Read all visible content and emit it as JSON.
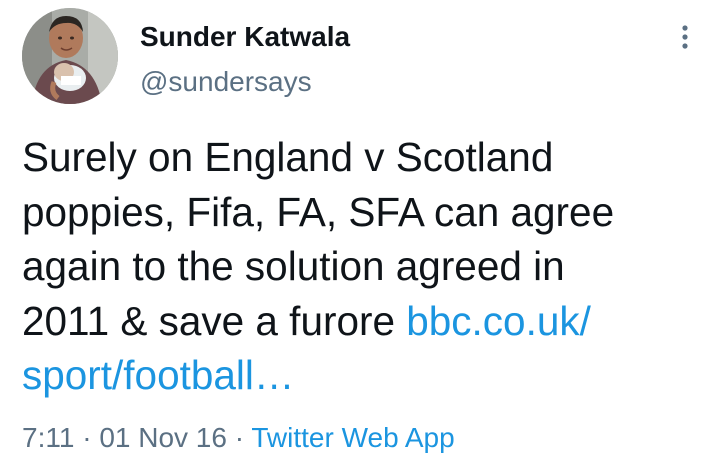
{
  "author": {
    "display_name": "Sunder Katwala",
    "handle": "@sundersays"
  },
  "tweet": {
    "text_lines": [
      "Surely on England v Scotland",
      "poppies, Fifa, FA, SFA can agree",
      "again to the solution agreed in",
      "2011 & save a furore "
    ],
    "link_part1": "bbc.co.uk/",
    "link_part2": "sport/football…"
  },
  "meta": {
    "time": "7:11",
    "separator": "·",
    "date": "01 Nov 16",
    "source": "Twitter Web App"
  },
  "icons": {
    "more": "more-vertical-icon",
    "avatar": "avatar-photo"
  },
  "colors": {
    "text": "#0f1419",
    "secondary": "#5b7083",
    "link": "#1b95e0",
    "background": "#ffffff"
  }
}
